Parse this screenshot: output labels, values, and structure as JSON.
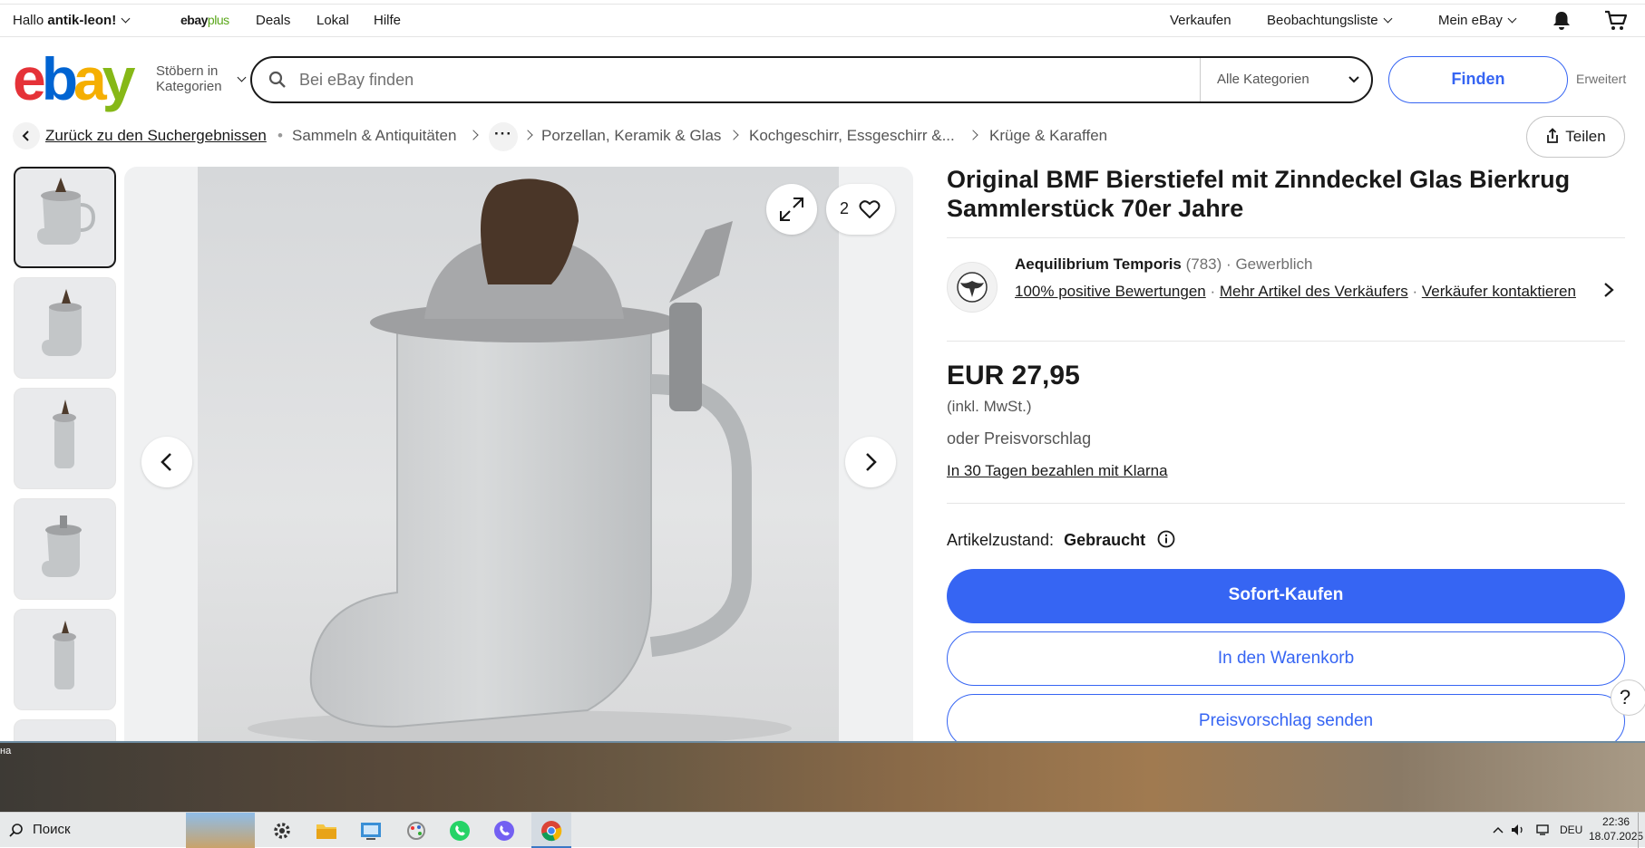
{
  "topnav": {
    "greeting_prefix": "Hallo",
    "username": "antik-leon!",
    "ebayplus_ebay": "ebay",
    "ebayplus_plus": "plus",
    "deals": "Deals",
    "lokal": "Lokal",
    "hilfe": "Hilfe",
    "verkaufen": "Verkaufen",
    "watchlist": "Beobachtungsliste",
    "mein_ebay": "Mein eBay"
  },
  "header": {
    "logo_letters": [
      "e",
      "b",
      "a",
      "y"
    ],
    "logo_colors": [
      "#e53238",
      "#0064d2",
      "#f5af02",
      "#86b817"
    ],
    "browse_line1": "Stöbern in",
    "browse_line2": "Kategorien",
    "search_placeholder": "Bei eBay finden",
    "category_select": "Alle Kategorien",
    "find_button": "Finden",
    "advanced": "Erweitert"
  },
  "breadcrumb": {
    "back": "Zurück zu den Suchergebnissen",
    "items": [
      "Sammeln & Antiquitäten",
      "Porzellan, Keramik & Glas",
      "Kochgeschirr, Essgeschirr &...",
      "Krüge & Karaffen"
    ],
    "more": "···"
  },
  "share_button": "Teilen",
  "gallery": {
    "thumbnail_count": 6,
    "favorite_count": "2",
    "icons": [
      "expand-icon",
      "heart-icon",
      "chevron-left-icon",
      "chevron-right-icon"
    ]
  },
  "item": {
    "title": "Original BMF Bierstiefel mit Zinndeckel Glas Bierkrug Sammlerstück 70er Jahre",
    "seller_name": "Aequilibrium Temporis",
    "seller_score": "(783)",
    "seller_dot": "·",
    "seller_type": "Gewerblich",
    "feedback_link": "100% positive Bewertungen",
    "more_items_link": "Mehr Artikel des Verkäufers",
    "contact_link": "Verkäufer kontaktieren",
    "price": "EUR 27,95",
    "vat": "(inkl. MwSt.)",
    "offer_text": "oder Preisvorschlag",
    "klarna": "In 30 Tagen bezahlen mit Klarna",
    "condition_label": "Artikelzustand:",
    "condition_value": "Gebraucht",
    "buy_now": "Sofort-Kaufen",
    "add_to_cart": "In den Warenkorb",
    "send_offer": "Preisvorschlag senden",
    "help": "?"
  },
  "taskbar": {
    "search": "Поиск",
    "lang": "DEU",
    "time": "22:36",
    "date": "18.07.2025",
    "edge_text": "на"
  },
  "colors": {
    "accent": "#3665f3",
    "text": "#191919",
    "muted": "#707070"
  }
}
